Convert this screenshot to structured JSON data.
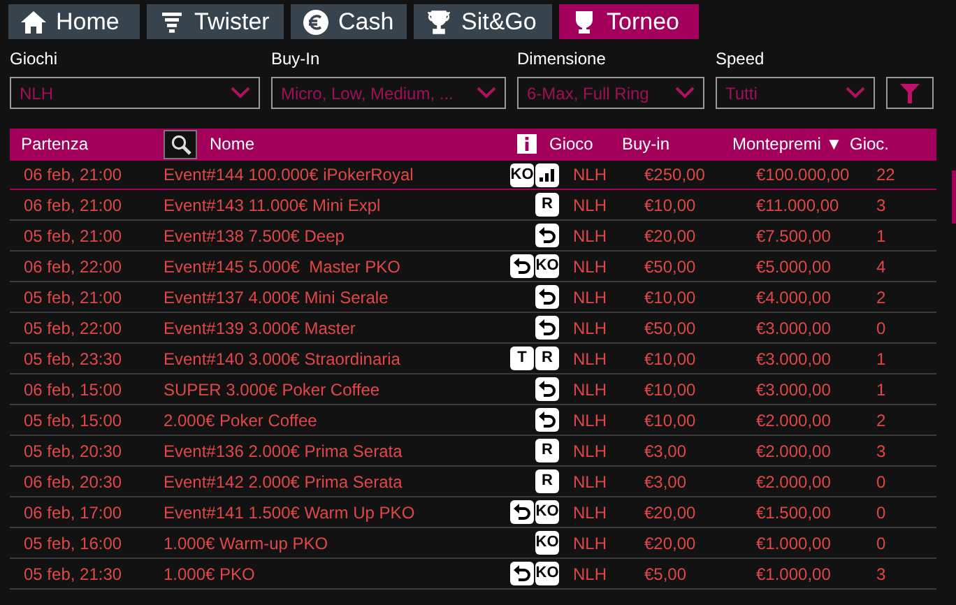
{
  "tabs": [
    {
      "label": "Home",
      "kind": "home",
      "selected": false
    },
    {
      "label": "Twister",
      "kind": "twister",
      "selected": false
    },
    {
      "label": "Cash",
      "kind": "cash",
      "selected": false
    },
    {
      "label": "Sit&Go",
      "kind": "trophy",
      "selected": false
    },
    {
      "label": "Torneo",
      "kind": "cup",
      "selected": true
    }
  ],
  "filters": [
    {
      "label": "Giochi",
      "value": "NLH"
    },
    {
      "label": "Buy-In",
      "value": "Micro, Low, Medium, ..."
    },
    {
      "label": "Dimensione",
      "value": "6-Max, Full Ring"
    },
    {
      "label": "Speed",
      "value": "Tutti"
    }
  ],
  "table": {
    "columns": {
      "start": "Partenza",
      "name": "Nome",
      "game": "Gioco",
      "buyin": "Buy-in",
      "prize": "Montepremi ▼",
      "players": "Gioc."
    },
    "rows": [
      {
        "start": "06 feb, 21:00",
        "name": "Event#144 100.000€ iPokerRoyal",
        "badges": [
          {
            "kind": "text",
            "label": "KO"
          },
          {
            "kind": "bars"
          }
        ],
        "game": "NLH",
        "buyin": "€250,00",
        "prize": "€100.000,00",
        "players": "22",
        "selected": true
      },
      {
        "start": "06 feb, 21:00",
        "name": "Event#143 11.000€ Mini Expl",
        "badges": [
          {
            "kind": "text",
            "label": "R"
          }
        ],
        "game": "NLH",
        "buyin": "€10,00",
        "prize": "€11.000,00",
        "players": "3",
        "selected": false
      },
      {
        "start": "05 feb, 21:00",
        "name": "Event#138 7.500€ Deep",
        "badges": [
          {
            "kind": "arrow"
          }
        ],
        "game": "NLH",
        "buyin": "€20,00",
        "prize": "€7.500,00",
        "players": "1",
        "selected": false
      },
      {
        "start": "06 feb, 22:00",
        "name": "Event#145 5.000€  Master PKO",
        "badges": [
          {
            "kind": "arrow"
          },
          {
            "kind": "text",
            "label": "KO"
          }
        ],
        "game": "NLH",
        "buyin": "€50,00",
        "prize": "€5.000,00",
        "players": "4",
        "selected": false
      },
      {
        "start": "05 feb, 21:00",
        "name": "Event#137 4.000€ Mini Serale",
        "badges": [
          {
            "kind": "arrow"
          }
        ],
        "game": "NLH",
        "buyin": "€10,00",
        "prize": "€4.000,00",
        "players": "2",
        "selected": false
      },
      {
        "start": "05 feb, 22:00",
        "name": "Event#139 3.000€ Master",
        "badges": [
          {
            "kind": "arrow"
          }
        ],
        "game": "NLH",
        "buyin": "€50,00",
        "prize": "€3.000,00",
        "players": "0",
        "selected": false
      },
      {
        "start": "05 feb, 23:30",
        "name": "Event#140 3.000€ Straordinaria",
        "badges": [
          {
            "kind": "text",
            "label": "T"
          },
          {
            "kind": "text",
            "label": "R"
          }
        ],
        "game": "NLH",
        "buyin": "€10,00",
        "prize": "€3.000,00",
        "players": "1",
        "selected": false
      },
      {
        "start": "06 feb, 15:00",
        "name": "SUPER 3.000€ Poker Coffee",
        "badges": [
          {
            "kind": "arrow"
          }
        ],
        "game": "NLH",
        "buyin": "€10,00",
        "prize": "€3.000,00",
        "players": "1",
        "selected": false
      },
      {
        "start": "05 feb, 15:00",
        "name": "2.000€ Poker Coffee",
        "badges": [
          {
            "kind": "arrow"
          }
        ],
        "game": "NLH",
        "buyin": "€10,00",
        "prize": "€2.000,00",
        "players": "2",
        "selected": false
      },
      {
        "start": "05 feb, 20:30",
        "name": "Event#136 2.000€ Prima Serata",
        "badges": [
          {
            "kind": "text",
            "label": "R"
          }
        ],
        "game": "NLH",
        "buyin": "€3,00",
        "prize": "€2.000,00",
        "players": "3",
        "selected": false
      },
      {
        "start": "06 feb, 20:30",
        "name": "Event#142 2.000€ Prima Serata",
        "badges": [
          {
            "kind": "text",
            "label": "R"
          }
        ],
        "game": "NLH",
        "buyin": "€3,00",
        "prize": "€2.000,00",
        "players": "0",
        "selected": false
      },
      {
        "start": "06 feb, 17:00",
        "name": "Event#141 1.500€ Warm Up PKO",
        "badges": [
          {
            "kind": "arrow"
          },
          {
            "kind": "text",
            "label": "KO"
          }
        ],
        "game": "NLH",
        "buyin": "€20,00",
        "prize": "€1.500,00",
        "players": "0",
        "selected": false
      },
      {
        "start": "05 feb, 16:00",
        "name": "1.000€ Warm-up PKO",
        "badges": [
          {
            "kind": "text",
            "label": "KO"
          }
        ],
        "game": "NLH",
        "buyin": "€20,00",
        "prize": "€1.000,00",
        "players": "0",
        "selected": false
      },
      {
        "start": "05 feb, 21:30",
        "name": "1.000€ PKO",
        "badges": [
          {
            "kind": "arrow"
          },
          {
            "kind": "text",
            "label": "KO"
          }
        ],
        "game": "NLH",
        "buyin": "€5,00",
        "prize": "€1.000,00",
        "players": "3",
        "selected": false
      }
    ]
  }
}
